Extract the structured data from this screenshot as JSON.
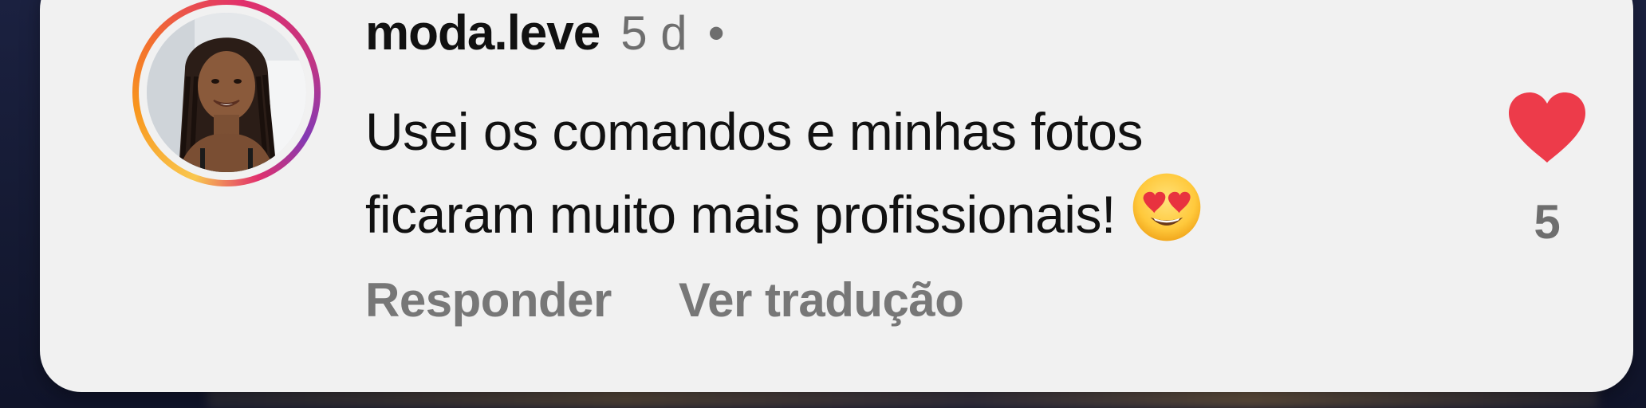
{
  "comment": {
    "username": "moda.leve",
    "time_ago": "5 d",
    "separator": "•",
    "text_line_1": "Usei os comandos e minhas fotos",
    "text_line_2": "ficaram muito mais profissionais!",
    "emoji_name": "heart-eyes-emoji"
  },
  "actions": {
    "reply_label": "Responder",
    "translate_label": "Ver tradução"
  },
  "like": {
    "icon": "heart-icon",
    "liked": true,
    "color": "#ed3b4a",
    "count": "5"
  },
  "avatar": {
    "icon": "profile-photo",
    "ring_colors": [
      "#f9c74f",
      "#f8961e",
      "#e1306c",
      "#c13584",
      "#833ab4"
    ]
  }
}
